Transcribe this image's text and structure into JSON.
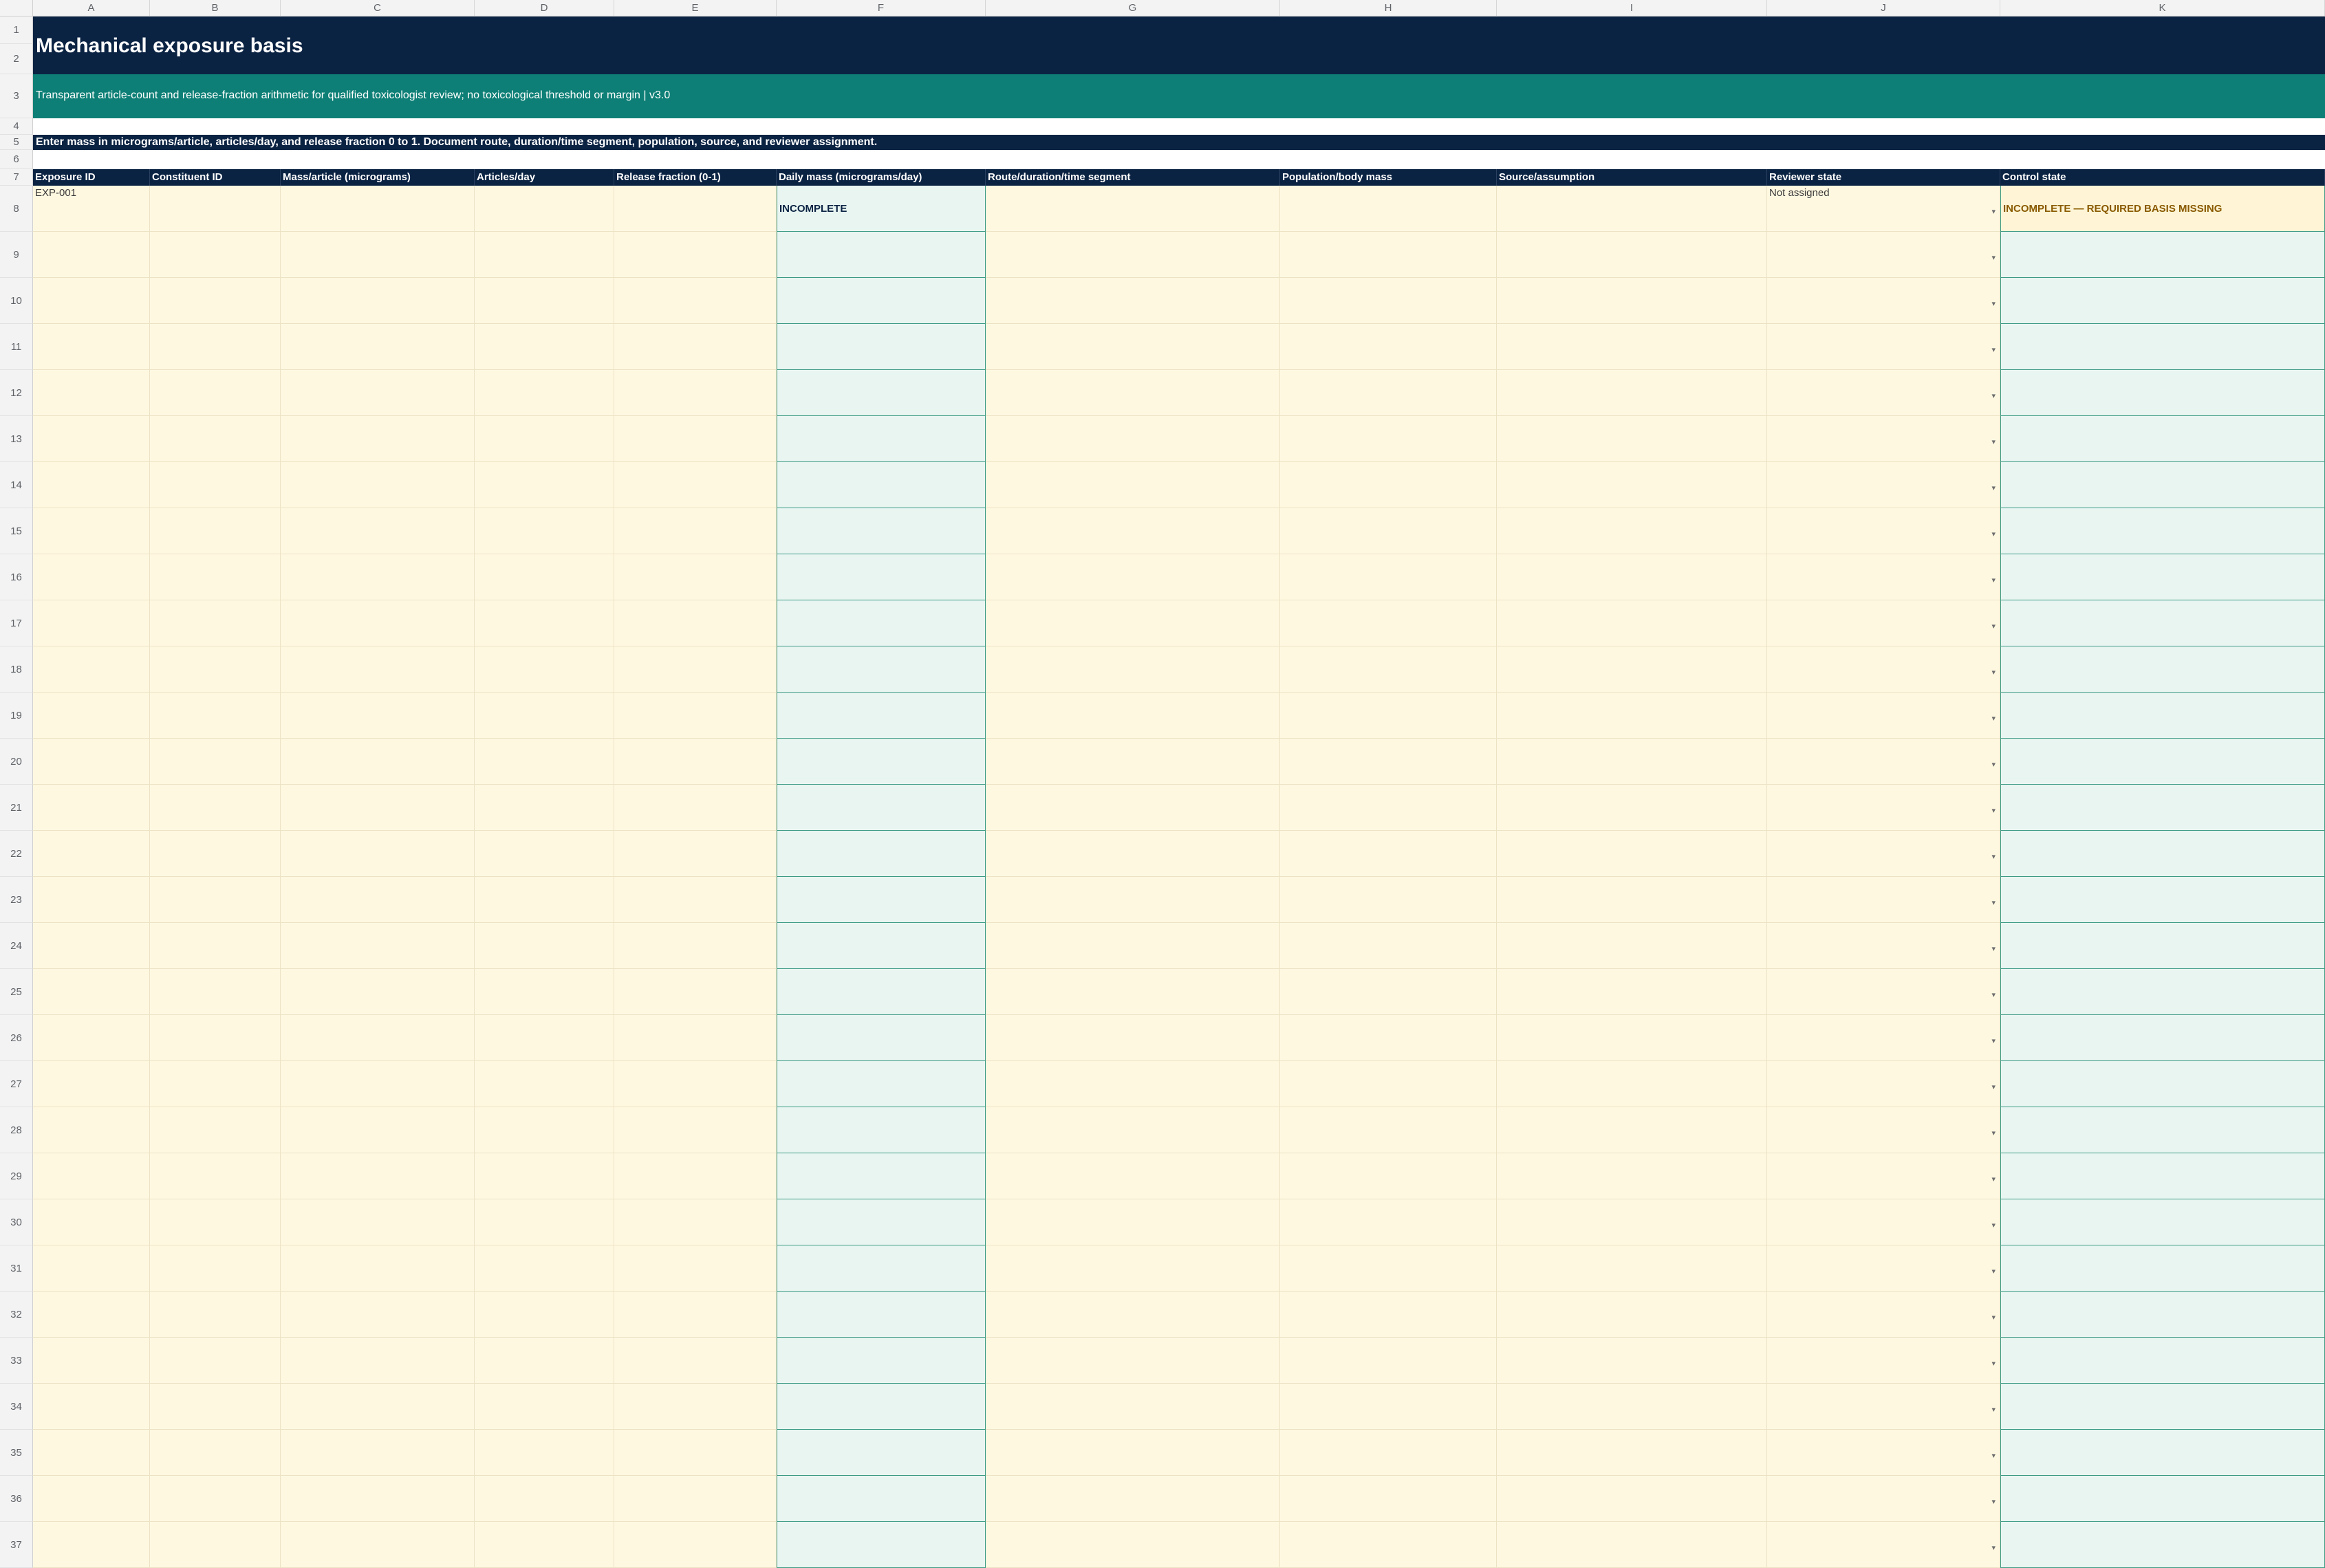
{
  "sheet": {
    "columns": [
      "A",
      "B",
      "C",
      "D",
      "E",
      "F",
      "G",
      "H",
      "I",
      "J",
      "K"
    ],
    "title": "Mechanical exposure basis",
    "subtitle": "Transparent article-count and release-fraction arithmetic for qualified toxicologist review; no toxicological threshold or margin | v3.0",
    "instruction": "Enter mass in micrograms/article, articles/day, and release fraction 0 to 1. Document route, duration/time segment, population, source, and reviewer assignment.",
    "headers": [
      "Exposure ID",
      "Constituent ID",
      "Mass/article (micrograms)",
      "Articles/day",
      "Release fraction (0-1)",
      "Daily mass (micrograms/day)",
      "Route/duration/time segment",
      "Population/body mass",
      "Source/assumption",
      "Reviewer state",
      "Control state"
    ],
    "row8": {
      "exposure_id": "EXP-001",
      "daily_mass": "INCOMPLETE",
      "reviewer_state": "Not assigned",
      "control_state": "INCOMPLETE — REQUIRED BASIS MISSING"
    },
    "dropdown_icon": "chevron-down-icon",
    "colors": {
      "navy": "#0b2343",
      "teal": "#0e7f76",
      "input": "#fff8e1",
      "calc": "#e8f5f1"
    }
  }
}
